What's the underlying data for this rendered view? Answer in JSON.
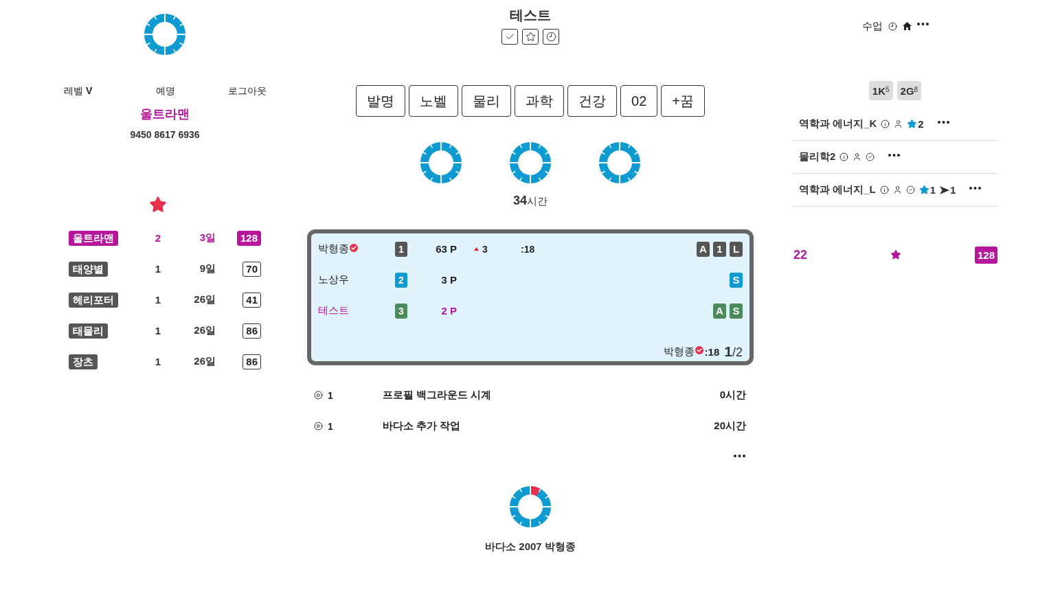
{
  "profile": {
    "links": [
      "레벨 **V**",
      "예명",
      "로그아웃"
    ],
    "name": "울트라맨",
    "number": "9450 8617 6936"
  },
  "ranking": [
    {
      "name": "울트라맨",
      "count": "2",
      "days": "3일",
      "score": "128",
      "highlighted": true
    },
    {
      "name": "태양별",
      "count": "1",
      "days": "9일",
      "score": "70",
      "highlighted": false
    },
    {
      "name": "헤리포터",
      "count": "1",
      "days": "26일",
      "score": "41",
      "highlighted": false
    },
    {
      "name": "태물리",
      "count": "1",
      "days": "26일",
      "score": "86",
      "highlighted": false
    },
    {
      "name": "장츠",
      "count": "1",
      "days": "26일",
      "score": "86",
      "highlighted": false
    }
  ],
  "header": {
    "title": "테스트"
  },
  "tabs": [
    "발명",
    "노벨",
    "물리",
    "과학",
    "건강",
    "02",
    "+꿈"
  ],
  "total": "**34**시간",
  "scoreboard": {
    "rows": [
      {
        "name": "박형종",
        "verified": true,
        "highlighted": false,
        "rank": "1",
        "color": "#555555",
        "points": "63 P",
        "change": "3",
        "time": ":18",
        "tags": [
          "A",
          "1",
          "L"
        ]
      },
      {
        "name": "노상우",
        "verified": false,
        "highlighted": false,
        "rank": "2",
        "color": "#0e9bd1",
        "points": "3 P",
        "tags": [
          "S"
        ]
      },
      {
        "name": "테스트",
        "verified": false,
        "highlighted": true,
        "rank": "3",
        "color": "#4b8b5b",
        "points": "2 P",
        "tags": [
          "A",
          "S"
        ]
      }
    ],
    "footer": {
      "name": "박형종",
      "verified": true,
      "time": ":18",
      "page": "**1**/2"
    }
  },
  "tasks": [
    {
      "count": "1",
      "title": "프로필 백그라운드 시계",
      "hours": "0시간"
    },
    {
      "count": "1",
      "title": "바다소 추가 작업",
      "hours": "20시간"
    }
  ],
  "caption": "바다소 2007 박형종",
  "sidebar": {
    "title": "수업",
    "chips": [
      "1K$^{5}$",
      "2G$^{8}$"
    ],
    "courses": [
      {
        "name": "역학과 에너지_K",
        "checked": false,
        "favorites": "2"
      },
      {
        "name": "물리학2",
        "checked": true
      },
      {
        "name": "역학과 에너지_L",
        "checked": true,
        "favorites": "1",
        "shares": "1"
      }
    ],
    "footer": {
      "count": "22",
      "score": "128"
    }
  }
}
